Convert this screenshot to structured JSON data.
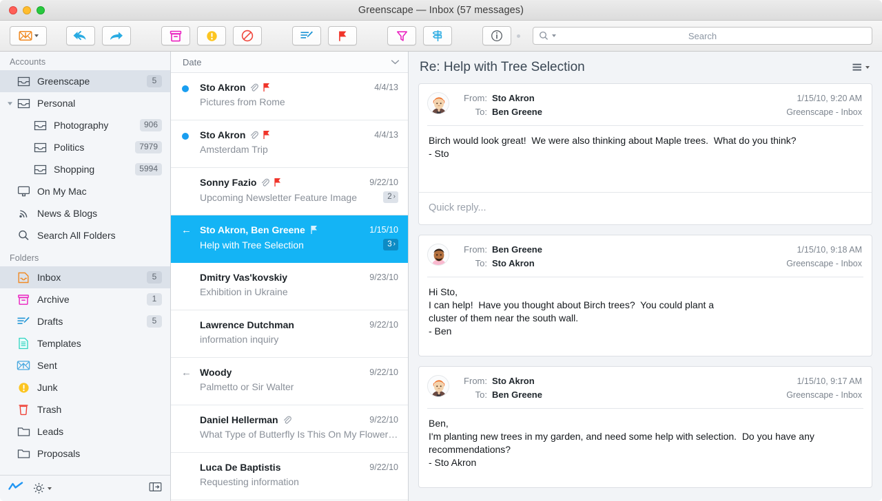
{
  "window": {
    "title": "Greenscape — Inbox (57 messages)",
    "traffic_lights": [
      "close",
      "minimize",
      "zoom"
    ]
  },
  "toolbar": {
    "buttons": [
      {
        "name": "get-mail-button",
        "icon": "get-mail-icon",
        "label": "",
        "has_caret": true
      },
      {
        "name": "reply-all-button",
        "icon": "reply-all-icon",
        "label": ""
      },
      {
        "name": "forward-button",
        "icon": "forward-icon",
        "label": ""
      },
      {
        "name": "archive-button",
        "icon": "archive-icon",
        "label": ""
      },
      {
        "name": "junk-button",
        "icon": "junk-icon",
        "label": ""
      },
      {
        "name": "block-button",
        "icon": "block-icon",
        "label": ""
      },
      {
        "name": "compose-button",
        "icon": "compose-icon",
        "label": ""
      },
      {
        "name": "flag-button",
        "icon": "flag-icon",
        "label": ""
      },
      {
        "name": "filter-button",
        "icon": "filter-icon",
        "label": ""
      },
      {
        "name": "sort-button",
        "icon": "sort-signpost-icon",
        "label": ""
      },
      {
        "name": "info-button",
        "icon": "info-icon",
        "label": ""
      }
    ],
    "search": {
      "placeholder": "Search",
      "icon": "search-icon",
      "value": ""
    }
  },
  "sidebar": {
    "accounts_header": "Accounts",
    "folders_header": "Folders",
    "accounts": [
      {
        "label": "Greenscape",
        "badge": "5",
        "icon": "mailbox-icon",
        "indent": 1,
        "selected": true,
        "twisty": ""
      },
      {
        "label": "Personal",
        "badge": "",
        "icon": "mailbox-icon",
        "indent": 0,
        "selected": false,
        "twisty": "down"
      },
      {
        "label": "Photography",
        "badge": "906",
        "icon": "mailbox-icon",
        "indent": 2,
        "selected": false,
        "twisty": ""
      },
      {
        "label": "Politics",
        "badge": "7979",
        "icon": "mailbox-icon",
        "indent": 2,
        "selected": false,
        "twisty": ""
      },
      {
        "label": "Shopping",
        "badge": "5994",
        "icon": "mailbox-icon",
        "indent": 2,
        "selected": false,
        "twisty": ""
      },
      {
        "label": "On My Mac",
        "badge": "",
        "icon": "computer-icon",
        "indent": 1,
        "selected": false,
        "twisty": ""
      },
      {
        "label": "News & Blogs",
        "badge": "",
        "icon": "rss-icon",
        "indent": 1,
        "selected": false,
        "twisty": ""
      },
      {
        "label": "Search All Folders",
        "badge": "",
        "icon": "search-icon",
        "indent": 1,
        "selected": false,
        "twisty": ""
      }
    ],
    "folders": [
      {
        "label": "Inbox",
        "badge": "5",
        "icon": "inbox-icon",
        "selected": true
      },
      {
        "label": "Archive",
        "badge": "1",
        "icon": "archive-icon",
        "selected": false
      },
      {
        "label": "Drafts",
        "badge": "5",
        "icon": "drafts-icon",
        "selected": false
      },
      {
        "label": "Templates",
        "badge": "",
        "icon": "templates-icon",
        "selected": false
      },
      {
        "label": "Sent",
        "badge": "",
        "icon": "sent-icon",
        "selected": false
      },
      {
        "label": "Junk",
        "badge": "",
        "icon": "junk-icon",
        "selected": false
      },
      {
        "label": "Trash",
        "badge": "",
        "icon": "trash-icon",
        "selected": false
      },
      {
        "label": "Leads",
        "badge": "",
        "icon": "folder-icon",
        "selected": false
      },
      {
        "label": "Proposals",
        "badge": "",
        "icon": "folder-icon",
        "selected": false
      }
    ],
    "footer": {
      "activity_icon": "activity-icon",
      "settings_icon": "gear-icon",
      "panel_toggle_icon": "panel-toggle-icon"
    }
  },
  "message_list": {
    "sort_column": "Date",
    "sort_caret_icon": "chevron-down-icon",
    "rows": [
      {
        "sender": "Sto Akron",
        "subject": "Pictures from Rome",
        "date": "4/4/13",
        "unread": true,
        "replied": false,
        "attachment": true,
        "flag": "red",
        "count": ""
      },
      {
        "sender": "Sto Akron",
        "subject": "Amsterdam Trip",
        "date": "4/4/13",
        "unread": true,
        "replied": false,
        "attachment": true,
        "flag": "red",
        "count": ""
      },
      {
        "sender": "Sonny Fazio",
        "subject": "Upcoming Newsletter Feature Image",
        "date": "9/22/10",
        "unread": false,
        "replied": false,
        "attachment": true,
        "flag": "red",
        "count": "2"
      },
      {
        "sender": "Sto Akron, Ben Greene",
        "subject": "Help with Tree Selection",
        "date": "1/15/10",
        "unread": false,
        "replied": true,
        "attachment": false,
        "flag": "white",
        "count": "3",
        "selected": true
      },
      {
        "sender": "Dmitry Vas'kovskiy",
        "subject": "Exhibition in Ukraine",
        "date": "9/23/10",
        "unread": false,
        "replied": false,
        "attachment": false,
        "flag": "",
        "count": ""
      },
      {
        "sender": "Lawrence Dutchman",
        "subject": "information inquiry",
        "date": "9/22/10",
        "unread": false,
        "replied": false,
        "attachment": false,
        "flag": "",
        "count": ""
      },
      {
        "sender": "Woody",
        "subject": "Palmetto or Sir Walter",
        "date": "9/22/10",
        "unread": false,
        "replied": true,
        "attachment": false,
        "flag": "",
        "count": ""
      },
      {
        "sender": "Daniel Hellerman",
        "subject": "What Type of Butterfly Is This On My Flowers?",
        "date": "9/22/10",
        "unread": false,
        "replied": false,
        "attachment": true,
        "flag": "",
        "count": ""
      },
      {
        "sender": "Luca De Baptistis",
        "subject": "Requesting information",
        "date": "9/22/10",
        "unread": false,
        "replied": false,
        "attachment": false,
        "flag": "",
        "count": ""
      }
    ]
  },
  "reader": {
    "thread_title": "Re: Help with Tree Selection",
    "actions_icon": "list-actions-icon",
    "from_label": "From:",
    "to_label": "To:",
    "quick_reply_placeholder": "Quick reply...",
    "messages": [
      {
        "from": "Sto Akron",
        "to": "Ben Greene",
        "timestamp": "1/15/10, 9:20 AM",
        "mailbox": "Greenscape - Inbox",
        "avatar": "avatar-sto-akron",
        "body": "Birch would look great!  We were also thinking about Maple trees.  What do you think?\n- Sto",
        "has_quick_reply": true
      },
      {
        "from": "Ben Greene",
        "to": "Sto Akron",
        "timestamp": "1/15/10, 9:18 AM",
        "mailbox": "Greenscape - Inbox",
        "avatar": "avatar-ben-greene",
        "body": "Hi Sto,\nI can help!  Have you thought about Birch trees?  You could plant a\ncluster of them near the south wall.\n- Ben",
        "has_quick_reply": false
      },
      {
        "from": "Sto Akron",
        "to": "Ben Greene",
        "timestamp": "1/15/10, 9:17 AM",
        "mailbox": "Greenscape - Inbox",
        "avatar": "avatar-sto-akron",
        "body": "Ben,\nI'm planting new trees in my garden, and need some help with selection.  Do you have any\nrecommendations?\n- Sto Akron",
        "has_quick_reply": false
      }
    ]
  },
  "colors": {
    "selection_blue": "#14b4f5",
    "accent_orange": "#f08a24",
    "accent_magenta": "#ea21c0",
    "accent_cyan": "#21b5e8",
    "flag_red": "#f0342a",
    "junk_yellow": "#fcc521",
    "trash_red": "#ef4136",
    "templates_teal": "#2ed3c0"
  }
}
